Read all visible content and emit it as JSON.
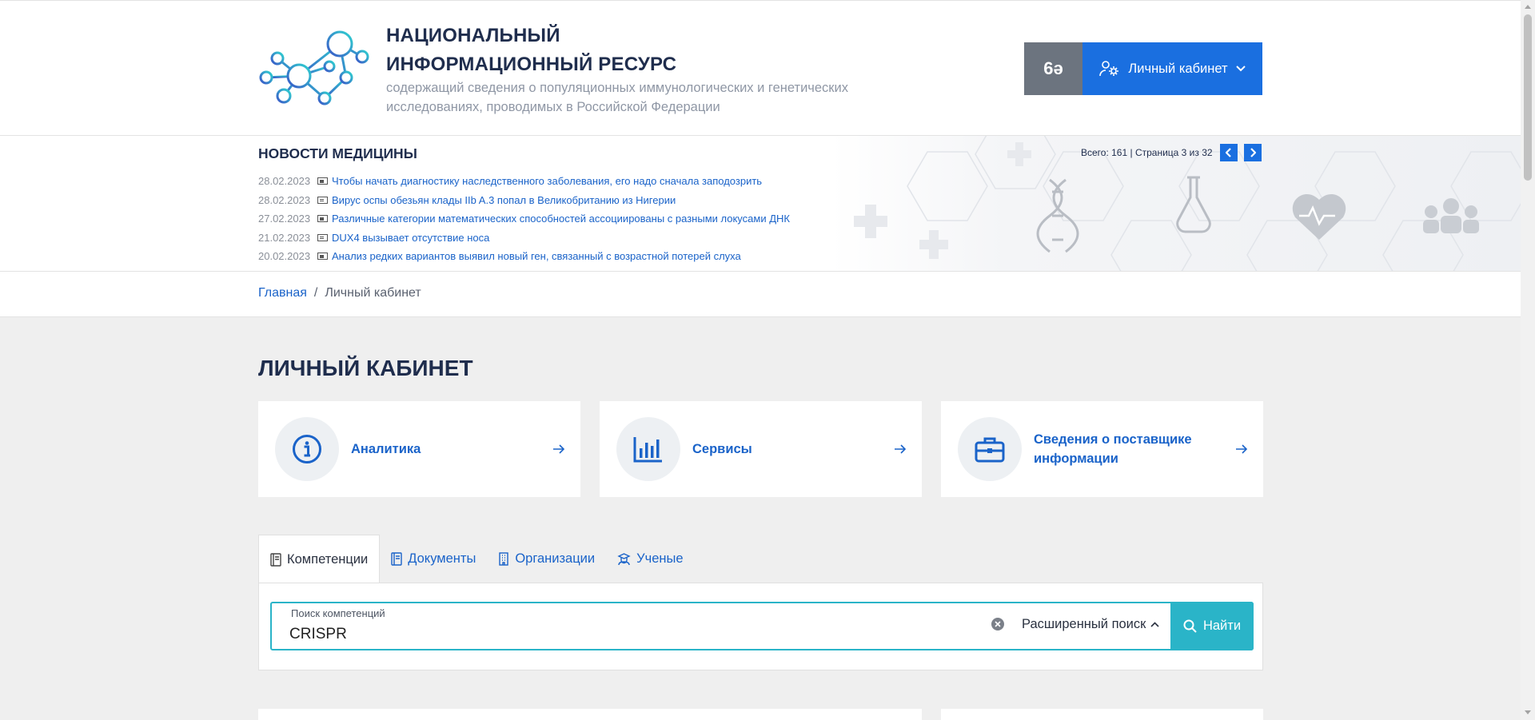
{
  "header": {
    "title_line1": "НАЦИОНАЛЬНЫЙ",
    "title_line2": "ИНФОРМАЦИОННЫЙ РЕСУРС",
    "subtitle": "содержащий сведения о популяционных иммунологических и генетических исследованиях, проводимых в Российской Федерации",
    "accessibility_label": "6ə",
    "cabinet_button": "Личный кабинет",
    "colors": {
      "primary": "#1a6fe0",
      "gray_button": "#6c747f",
      "accent": "#2ab4c8"
    }
  },
  "news": {
    "title": "НОВОСТИ МЕДИЦИНЫ",
    "pager_text": "Всего: 161 | Страница 3 из 32",
    "items": [
      {
        "date": "28.02.2023",
        "text": "Чтобы начать диагностику наследственного заболевания, его надо сначала заподозрить"
      },
      {
        "date": "28.02.2023",
        "text": "Вирус оспы обезьян клады IIb A.3 попал в Великобританию из Нигерии"
      },
      {
        "date": "27.02.2023",
        "text": "Различные категории математических способностей ассоциированы с разными локусами ДНК"
      },
      {
        "date": "21.02.2023",
        "text": "DUX4 вызывает отсутствие носа"
      },
      {
        "date": "20.02.2023",
        "text": "Анализ редких вариантов выявил новый ген, связанный с возрастной потерей слуха"
      }
    ]
  },
  "breadcrumb": {
    "home": "Главная",
    "separator": "/",
    "current": "Личный кабинет"
  },
  "page": {
    "title": "ЛИЧНЫЙ КАБИНЕТ"
  },
  "cards": [
    {
      "label": "Аналитика",
      "icon": "info-icon"
    },
    {
      "label": "Сервисы",
      "icon": "bar-chart-icon"
    },
    {
      "label": "Сведения о поставщике информации",
      "icon": "briefcase-icon"
    }
  ],
  "tabs": [
    {
      "label": "Компетенции",
      "icon": "book-icon",
      "active": true
    },
    {
      "label": "Документы",
      "icon": "document-icon",
      "active": false
    },
    {
      "label": "Организации",
      "icon": "building-icon",
      "active": false
    },
    {
      "label": "Ученые",
      "icon": "scientist-icon",
      "active": false
    }
  ],
  "search": {
    "label": "Поиск компетенций",
    "value": "CRISPR",
    "advanced": "Расширенный поиск",
    "button": "Найти"
  }
}
